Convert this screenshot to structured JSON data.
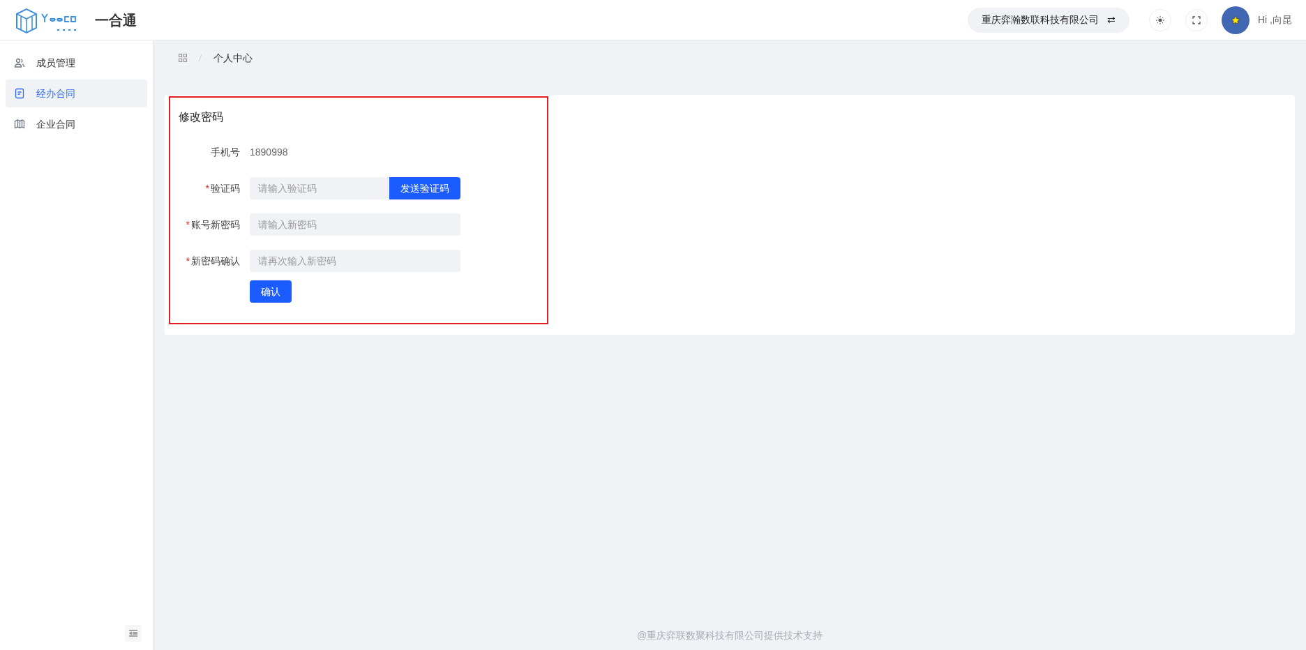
{
  "header": {
    "app_title": "一合通",
    "company": "重庆弈瀚数联科技有限公司",
    "swap_symbol": "⇄",
    "greeting": "Hi ,向昆"
  },
  "sidebar": {
    "items": [
      {
        "label": "成员管理",
        "kind": "members",
        "selected": false
      },
      {
        "label": "经办合同",
        "kind": "handled",
        "selected": true
      },
      {
        "label": "企业合同",
        "kind": "company",
        "selected": false
      }
    ]
  },
  "breadcrumb": [
    "个人中心"
  ],
  "form": {
    "title": "修改密码",
    "highlighted": true,
    "fields": [
      {
        "kind": "text",
        "label": "手机号",
        "value": "1890998"
      },
      {
        "kind": "code",
        "label": "验证码",
        "required_mark": "*",
        "placeholder": "请输入验证码",
        "button": "发送验证码"
      },
      {
        "kind": "input",
        "label": "账号新密码",
        "required_mark": "*",
        "placeholder": "请输入新密码"
      },
      {
        "kind": "input",
        "label": "新密码确认",
        "required_mark": "*",
        "placeholder": "请再次输入新密码"
      }
    ],
    "submit": "确认"
  },
  "footer": "@重庆弈联数聚科技有限公司提供技术支持"
}
